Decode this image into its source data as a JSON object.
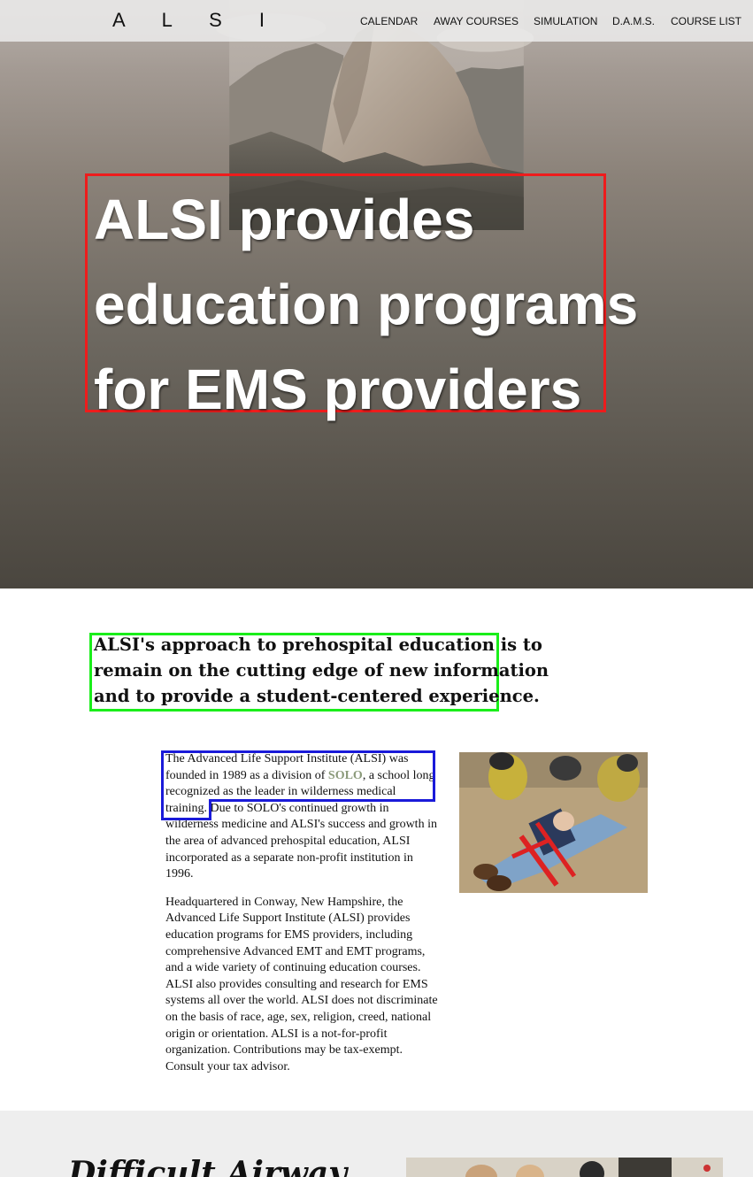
{
  "brand": {
    "logo": "A L S I"
  },
  "nav": {
    "items": [
      {
        "label": "CALENDAR"
      },
      {
        "label": "AWAY COURSES"
      },
      {
        "label": "SIMULATION"
      },
      {
        "label": "D.A.M.S."
      },
      {
        "label": "COURSE LIST"
      }
    ]
  },
  "hero": {
    "headline_lines": [
      "ALSI provides",
      "education programs",
      "for EMS providers"
    ]
  },
  "mission": {
    "lines": [
      "ALSI's approach to prehospital education is to",
      "remain on the cutting edge of new information",
      "and to provide a student-centered experience."
    ]
  },
  "about": {
    "p1": {
      "line1": "The Advanced Life Support Institute (ALSI) was",
      "line2_pre": "founded in 1989 as a division of ",
      "link": "SOLO",
      "line2_post": ", a school long",
      "line3": "recognized as the leader in wilderness medical",
      "line4_a": "training.",
      "line4_b": " Due to SOLO's continued growth in",
      "line5": "wilderness medicine and ALSI's success and growth in",
      "line6": "the area of advanced prehospital education, ALSI",
      "line7": "incorporated as a separate non-profit institution in",
      "line8": "1996."
    },
    "p2": {
      "lines": [
        "Headquartered in Conway, New Hampshire, the",
        "Advanced Life Support Institute (ALSI) provides",
        "education programs for EMS providers, including",
        "comprehensive Advanced EMT and EMT programs,",
        "and a wide variety of continuing education courses.",
        "ALSI also provides consulting and research for EMS",
        "systems all over the world. ALSI does not discriminate",
        "on the basis of race, age, sex, religion, creed, national",
        "origin or orientation. ALSI is a not-for-profit",
        "organization. Contributions may be tax-exempt.",
        "Consult your tax advisor."
      ]
    }
  },
  "section2": {
    "heading": "Difficult Airway"
  },
  "colors": {
    "nav_bg": "#ebebeb",
    "headline_box": "#ee1c1c",
    "mission_box": "#1aee1a",
    "highlight_box": "#1a1ad9",
    "solo_link": "#8b9a7a",
    "section_gray": "#eeeeee"
  }
}
